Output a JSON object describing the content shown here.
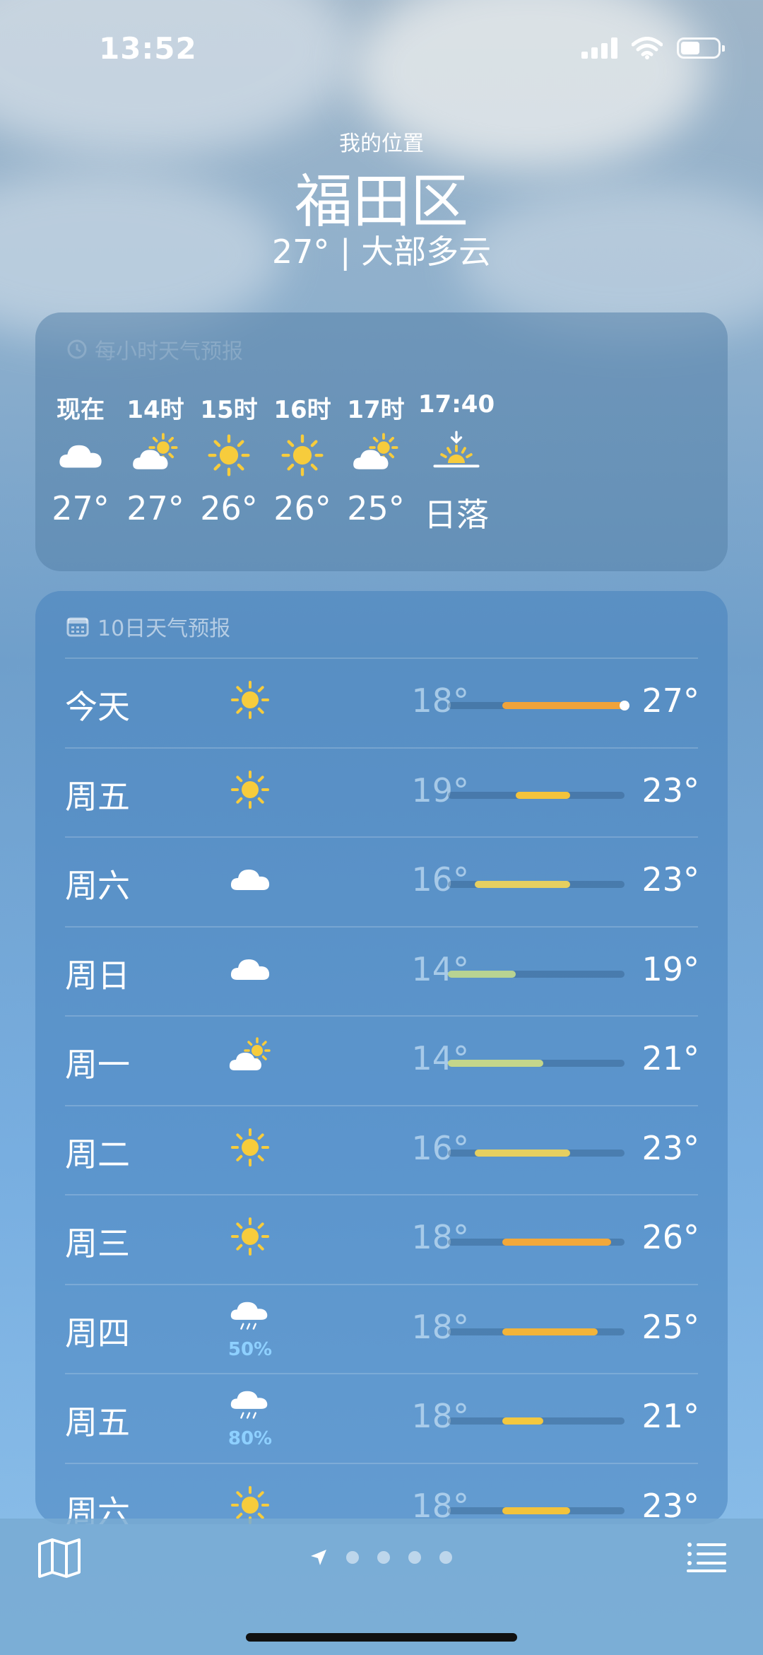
{
  "status": {
    "time": "13:52"
  },
  "location": {
    "subtitle": "我的位置",
    "city": "福田区",
    "condition": "27° | 大部多云"
  },
  "hourly": {
    "header": "每小时天气预报",
    "items": [
      {
        "label": "现在",
        "icon": "cloud-icon",
        "temp": "27°"
      },
      {
        "label": "14时",
        "icon": "partly-sunny-icon",
        "temp": "27°"
      },
      {
        "label": "15时",
        "icon": "sun-icon",
        "temp": "26°"
      },
      {
        "label": "16时",
        "icon": "sun-icon",
        "temp": "26°"
      },
      {
        "label": "17时",
        "icon": "partly-sunny-icon",
        "temp": "25°"
      },
      {
        "label": "17:40",
        "icon": "sunset-icon",
        "temp": "日落"
      }
    ]
  },
  "daily": {
    "header": "10日天气预报",
    "range": {
      "min": 14,
      "max": 27
    },
    "days": [
      {
        "name": "今天",
        "icon": "sun-icon",
        "pop": "",
        "low": "18°",
        "high": "27°",
        "lo": 18,
        "hi": 27,
        "current": 27,
        "color": "#f0a33a"
      },
      {
        "name": "周五",
        "icon": "sun-icon",
        "pop": "",
        "low": "19°",
        "high": "23°",
        "lo": 19,
        "hi": 23,
        "color": "#f3c33c"
      },
      {
        "name": "周六",
        "icon": "cloud-icon",
        "pop": "",
        "low": "16°",
        "high": "23°",
        "lo": 16,
        "hi": 23,
        "color": "#e6cf60"
      },
      {
        "name": "周日",
        "icon": "cloud-icon",
        "pop": "",
        "low": "14°",
        "high": "19°",
        "lo": 14,
        "hi": 19,
        "color": "#b8d392"
      },
      {
        "name": "周一",
        "icon": "partly-sunny-icon",
        "pop": "",
        "low": "14°",
        "high": "21°",
        "lo": 14,
        "hi": 21,
        "color": "#c5d68a"
      },
      {
        "name": "周二",
        "icon": "sun-icon",
        "pop": "",
        "low": "16°",
        "high": "23°",
        "lo": 16,
        "hi": 23,
        "color": "#e6cf60"
      },
      {
        "name": "周三",
        "icon": "sun-icon",
        "pop": "",
        "low": "18°",
        "high": "26°",
        "lo": 18,
        "hi": 26,
        "color": "#f2a83a"
      },
      {
        "name": "周四",
        "icon": "rain-icon",
        "pop": "50%",
        "low": "18°",
        "high": "25°",
        "lo": 18,
        "hi": 25,
        "color": "#f2b43a"
      },
      {
        "name": "周五",
        "icon": "rain-icon",
        "pop": "80%",
        "low": "18°",
        "high": "21°",
        "lo": 18,
        "hi": 21,
        "color": "#f3c840"
      },
      {
        "name": "周六",
        "icon": "sun-icon",
        "pop": "",
        "low": "18°",
        "high": "23°",
        "lo": 18,
        "hi": 23,
        "color": "#f3c33c"
      }
    ]
  },
  "colors": {
    "sun": "#f7cc3c",
    "cloud": "#ffffff",
    "pop": "#8ed0ff"
  }
}
